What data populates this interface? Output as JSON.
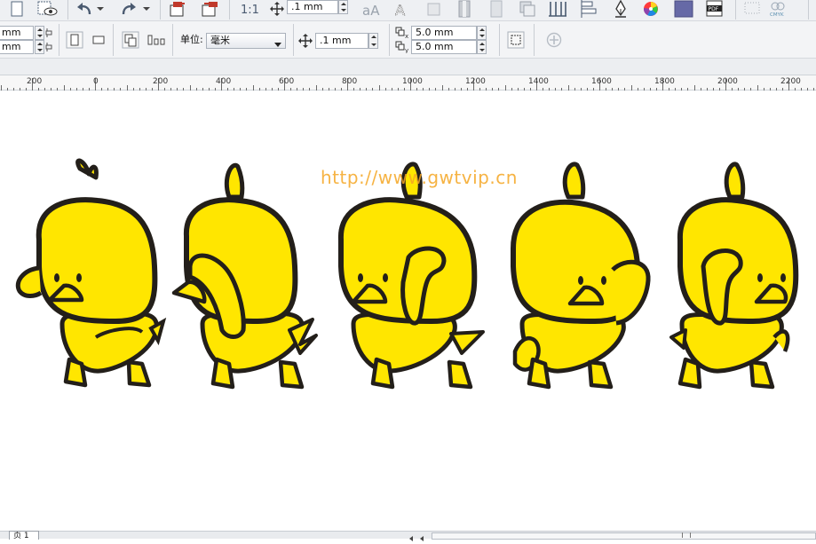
{
  "toolbar_top": {
    "icons": [
      "new-page-icon",
      "view-icon",
      "undo-icon",
      "undo-dropdown-icon",
      "redo-icon",
      "redo-dropdown-icon",
      "import-icon",
      "export-icon",
      "scale-icon",
      "nudge-icon",
      "text-size-icon",
      "text-outline-icon",
      "refresh-icon",
      "gradient-bar-icon",
      "gradient-bar-light-icon",
      "copy-pages-icon",
      "table-columns-icon",
      "align-icon",
      "pen-icon",
      "color-wheel-icon",
      "color-swatch-icon",
      "pdf-icon",
      "dotted-grid-icon",
      "cmyk-icon"
    ],
    "nudge_value": ".1 mm",
    "cmyk_label": "CMYK",
    "pdf_label": "PDF"
  },
  "toolbar_props": {
    "width_value": "mm",
    "height_value": "mm",
    "units_label": "单位:",
    "units_value": "毫米",
    "nudge_value": ".1 mm",
    "dup_x_value": "5.0 mm",
    "dup_y_value": "5.0 mm"
  },
  "ruler": {
    "labels": [
      "200",
      "0",
      "200",
      "400",
      "600",
      "800",
      "1000",
      "1200",
      "1400",
      "1600",
      "1800",
      "2000",
      "2200"
    ]
  },
  "canvas": {
    "watermark": "http://www.gwtvip.cn",
    "ducks": 5,
    "colors": {
      "body": "#ffe600",
      "outline": "#231f1a",
      "beak": "#ffe600"
    }
  },
  "statusbar": {
    "page_tab": "页 1"
  }
}
